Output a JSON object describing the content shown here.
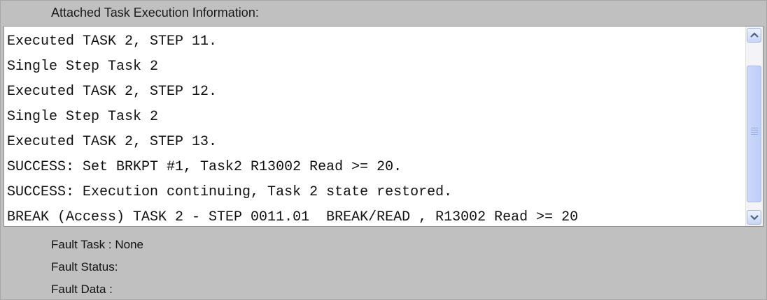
{
  "panel": {
    "title": "Attached Task Execution Information:"
  },
  "log": {
    "lines": [
      "Executed TASK 2, STEP 11.",
      "Single Step Task 2",
      "Executed TASK 2, STEP 12.",
      "Single Step Task 2",
      "Executed TASK 2, STEP 13.",
      "SUCCESS: Set BRKPT #1, Task2 R13002 Read >= 20.",
      "SUCCESS: Execution continuing, Task 2 state restored.",
      "BREAK (Access) TASK 2 - STEP 0011.01  BREAK/READ , R13002 Read >= 20"
    ]
  },
  "fault": {
    "task": "Fault Task : None",
    "status": "Fault Status:",
    "data": "Fault Data :"
  },
  "icons": {
    "scroll_up": "scroll-up-arrow-icon",
    "scroll_down": "scroll-down-arrow-icon",
    "thumb_grip": "scroll-thumb-grip-icon"
  }
}
